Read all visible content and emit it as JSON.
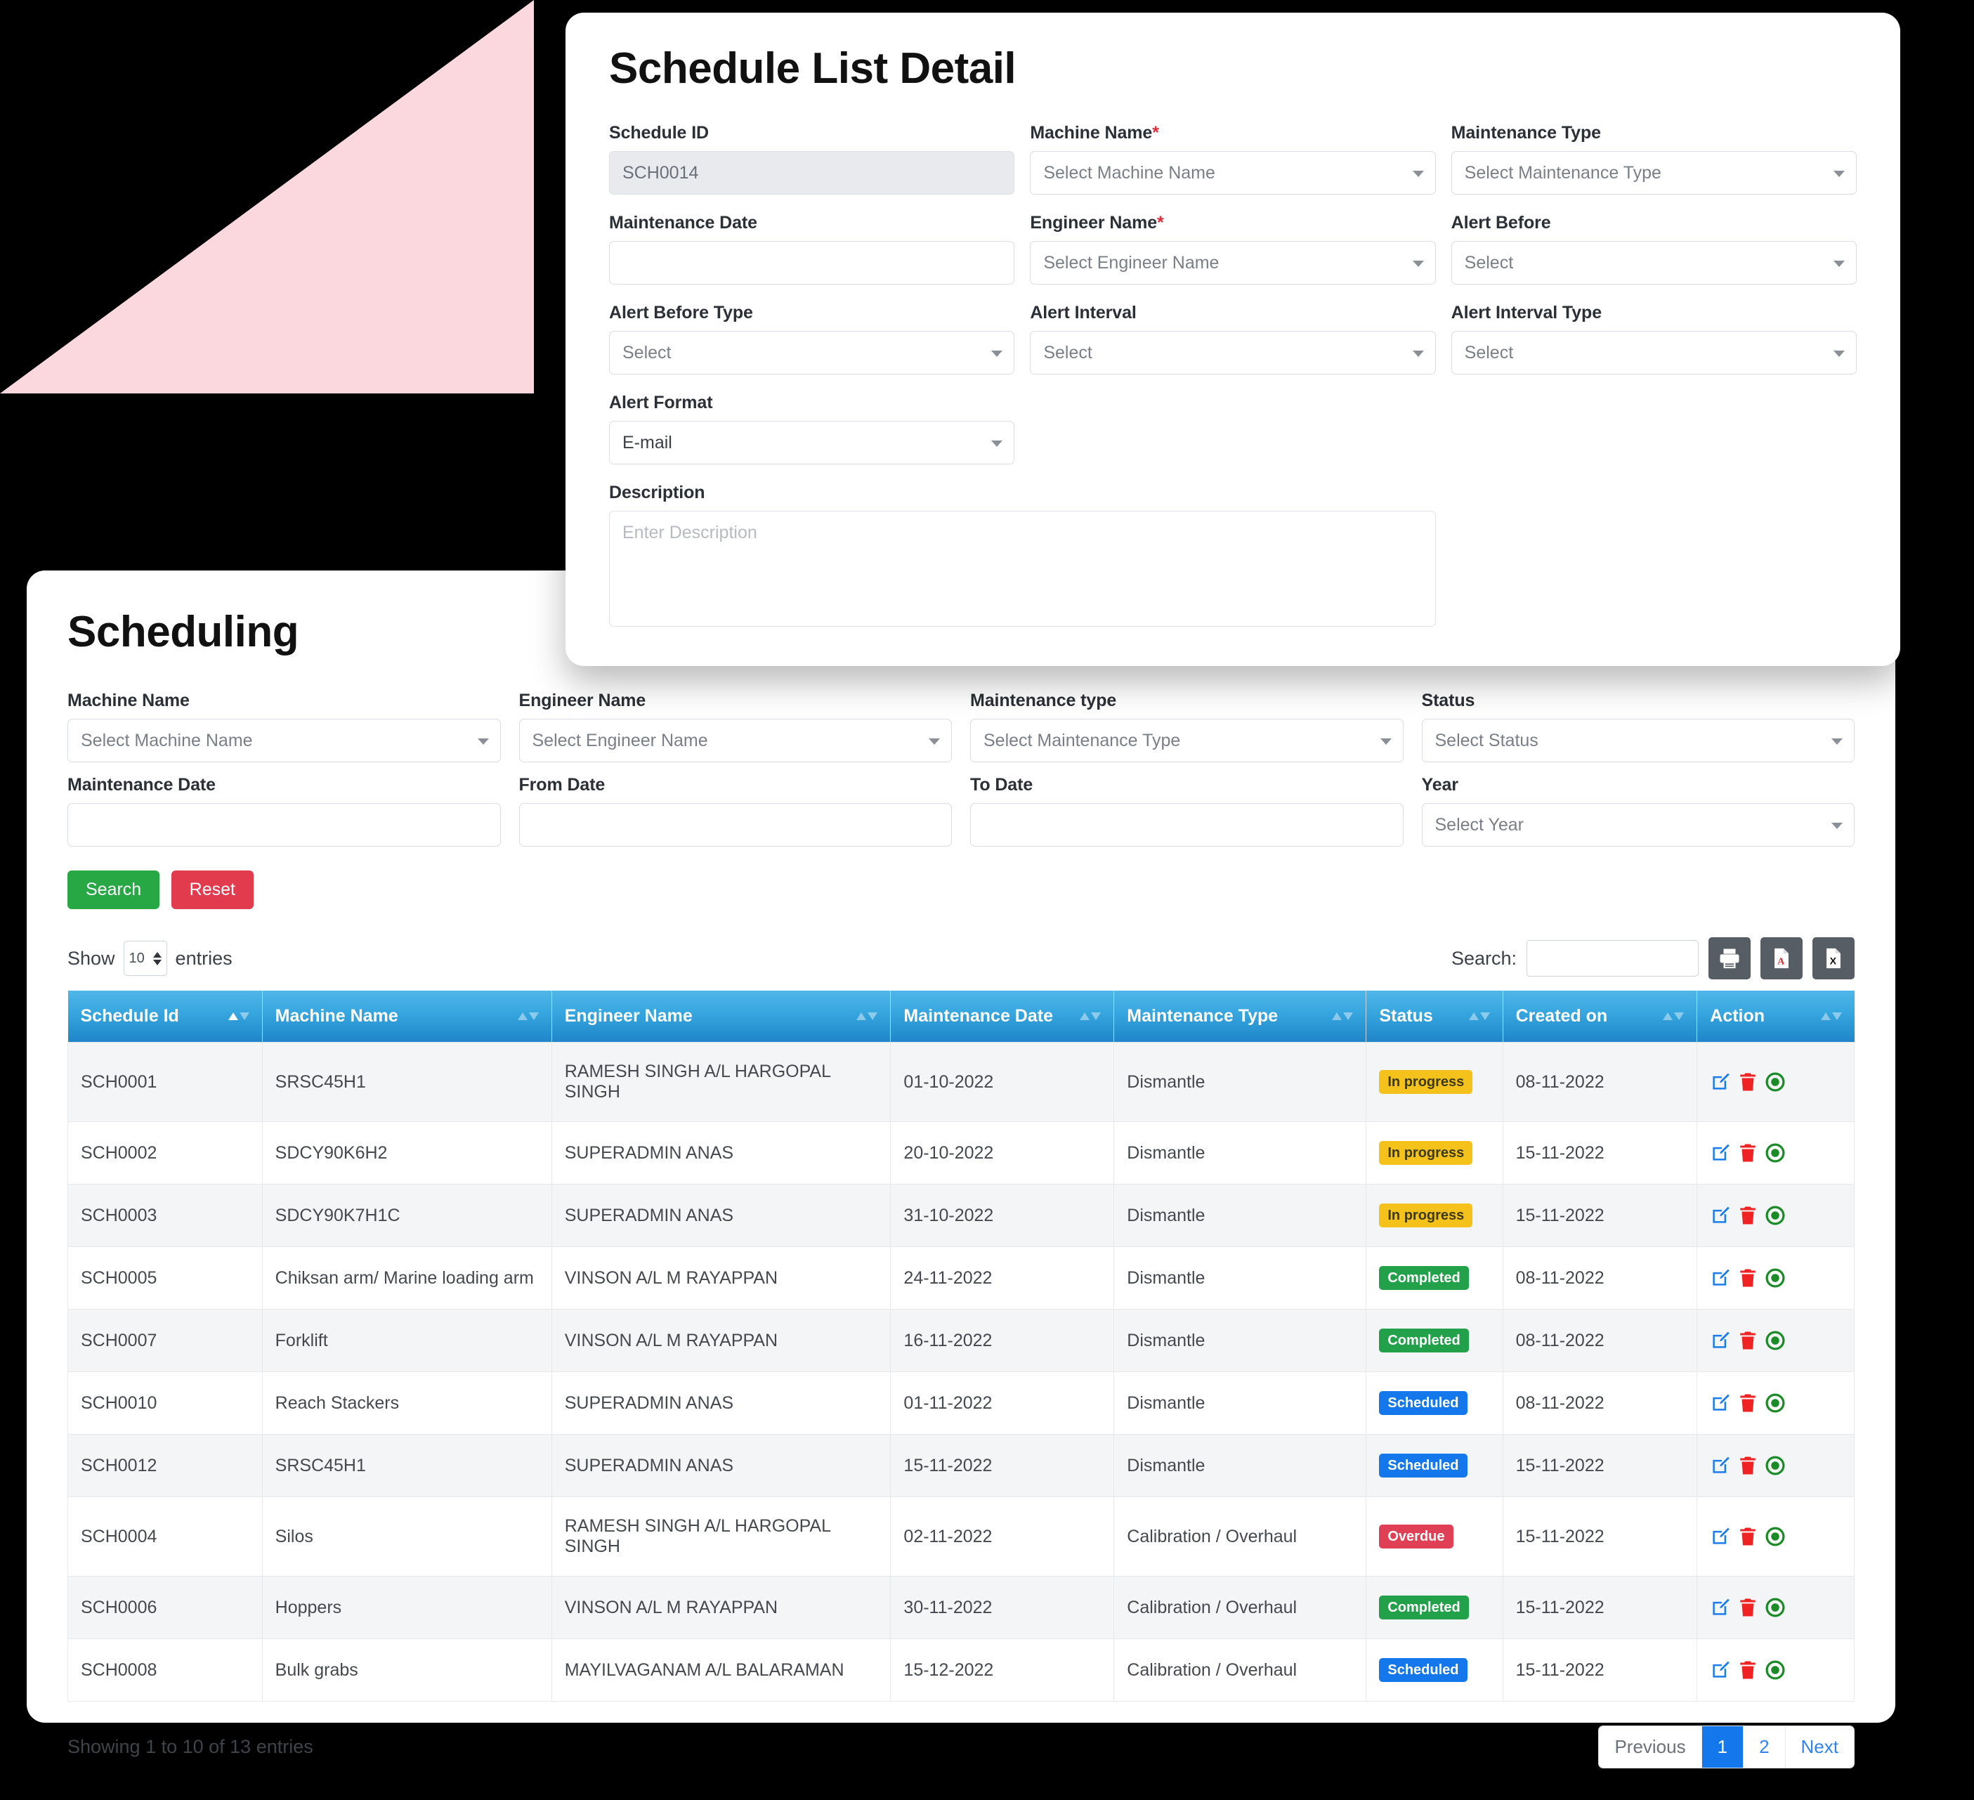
{
  "modal": {
    "title": "Schedule List Detail",
    "fields": [
      {
        "label": "Schedule ID",
        "required": false,
        "type": "text-readonly",
        "value": "SCH0014",
        "placeholder": ""
      },
      {
        "label": "Machine Name",
        "required": true,
        "type": "select",
        "value": "Select Machine Name"
      },
      {
        "label": "Maintenance Type",
        "required": false,
        "type": "select",
        "value": "Select Maintenance Type"
      },
      {
        "label": "Maintenance Date",
        "required": false,
        "type": "text",
        "value": ""
      },
      {
        "label": "Engineer Name",
        "required": true,
        "type": "select",
        "value": "Select Engineer Name"
      },
      {
        "label": "Alert Before",
        "required": false,
        "type": "select",
        "value": "Select"
      },
      {
        "label": "Alert Before Type",
        "required": false,
        "type": "select",
        "value": "Select"
      },
      {
        "label": "Alert Interval",
        "required": false,
        "type": "select",
        "value": "Select"
      },
      {
        "label": "Alert Interval Type",
        "required": false,
        "type": "select",
        "value": "Select"
      },
      {
        "label": "Alert Format",
        "required": false,
        "type": "select",
        "value": "E-mail"
      }
    ],
    "description": {
      "label": "Description",
      "placeholder": "Enter Description",
      "value": ""
    },
    "required_marker": "*"
  },
  "list": {
    "title": "Scheduling",
    "filters": [
      {
        "label": "Machine Name",
        "type": "select",
        "value": "Select Machine Name"
      },
      {
        "label": "Engineer Name",
        "type": "select",
        "value": "Select Engineer Name"
      },
      {
        "label": "Maintenance type",
        "type": "select",
        "value": "Select Maintenance Type"
      },
      {
        "label": "Status",
        "type": "select",
        "value": "Select Status"
      },
      {
        "label": "Maintenance Date",
        "type": "text",
        "value": ""
      },
      {
        "label": "From Date",
        "type": "text",
        "value": ""
      },
      {
        "label": "To Date",
        "type": "text",
        "value": ""
      },
      {
        "label": "Year",
        "type": "select",
        "value": "Select Year"
      }
    ],
    "buttons": {
      "search": "Search",
      "reset": "Reset"
    },
    "table_controls": {
      "show_label": "Show",
      "entries_value": "10",
      "entries_label": "entries",
      "search_label": "Search:",
      "search_value": "",
      "export": [
        {
          "name": "print-icon",
          "title": "Print"
        },
        {
          "name": "pdf-icon",
          "title": "PDF"
        },
        {
          "name": "excel-icon",
          "title": "Excel"
        }
      ]
    },
    "columns": [
      {
        "label": "Schedule Id",
        "sort": "asc"
      },
      {
        "label": "Machine Name",
        "sort": "none"
      },
      {
        "label": "Engineer Name",
        "sort": "none"
      },
      {
        "label": "Maintenance Date",
        "sort": "none"
      },
      {
        "label": "Maintenance Type",
        "sort": "none"
      },
      {
        "label": "Status",
        "sort": "none"
      },
      {
        "label": "Created on",
        "sort": "none"
      },
      {
        "label": "Action",
        "sort": "none"
      }
    ],
    "rows": [
      {
        "id": "SCH0001",
        "machine": "SRSC45H1",
        "engineer": "RAMESH SINGH A/L HARGOPAL SINGH",
        "date": "01-10-2022",
        "mtype": "Dismantle",
        "status": "In progress",
        "status_key": "inprogress",
        "created": "08-11-2022"
      },
      {
        "id": "SCH0002",
        "machine": "SDCY90K6H2",
        "engineer": "SUPERADMIN ANAS",
        "date": "20-10-2022",
        "mtype": "Dismantle",
        "status": "In progress",
        "status_key": "inprogress",
        "created": "15-11-2022"
      },
      {
        "id": "SCH0003",
        "machine": "SDCY90K7H1C",
        "engineer": "SUPERADMIN ANAS",
        "date": "31-10-2022",
        "mtype": "Dismantle",
        "status": "In progress",
        "status_key": "inprogress",
        "created": "15-11-2022"
      },
      {
        "id": "SCH0005",
        "machine": "Chiksan arm/ Marine loading arm",
        "engineer": "VINSON A/L M RAYAPPAN",
        "date": "24-11-2022",
        "mtype": "Dismantle",
        "status": "Completed",
        "status_key": "completed",
        "created": "08-11-2022"
      },
      {
        "id": "SCH0007",
        "machine": "Forklift",
        "engineer": "VINSON A/L M RAYAPPAN",
        "date": "16-11-2022",
        "mtype": "Dismantle",
        "status": "Completed",
        "status_key": "completed",
        "created": "08-11-2022"
      },
      {
        "id": "SCH0010",
        "machine": "Reach Stackers",
        "engineer": "SUPERADMIN ANAS",
        "date": "01-11-2022",
        "mtype": "Dismantle",
        "status": "Scheduled",
        "status_key": "scheduled",
        "created": "08-11-2022"
      },
      {
        "id": "SCH0012",
        "machine": "SRSC45H1",
        "engineer": "SUPERADMIN ANAS",
        "date": "15-11-2022",
        "mtype": "Dismantle",
        "status": "Scheduled",
        "status_key": "scheduled",
        "created": "15-11-2022"
      },
      {
        "id": "SCH0004",
        "machine": "Silos",
        "engineer": "RAMESH SINGH A/L HARGOPAL SINGH",
        "date": "02-11-2022",
        "mtype": "Calibration / Overhaul",
        "status": "Overdue",
        "status_key": "overdue",
        "created": "15-11-2022"
      },
      {
        "id": "SCH0006",
        "machine": "Hoppers",
        "engineer": "VINSON A/L M RAYAPPAN",
        "date": "30-11-2022",
        "mtype": "Calibration / Overhaul",
        "status": "Completed",
        "status_key": "completed",
        "created": "15-11-2022"
      },
      {
        "id": "SCH0008",
        "machine": "Bulk grabs",
        "engineer": "MAYILVAGANAM A/L BALARAMAN",
        "date": "15-12-2022",
        "mtype": "Calibration / Overhaul",
        "status": "Scheduled",
        "status_key": "scheduled",
        "created": "15-11-2022"
      }
    ],
    "row_actions": [
      {
        "name": "edit-icon",
        "color": "#1b7ced"
      },
      {
        "name": "delete-icon",
        "color": "#ef2323"
      },
      {
        "name": "view-icon",
        "color": "#1a8b26"
      }
    ],
    "footer": {
      "showing": "Showing 1 to 10 of 13 entries",
      "pagination": {
        "previous": "Previous",
        "pages": [
          "1",
          "2"
        ],
        "active_page": "1",
        "next": "Next"
      }
    }
  },
  "colors": {
    "accent_blue": "#1f86c9",
    "header_gradient_top": "#4fb6e8",
    "header_gradient_bottom": "#1f86c9",
    "success": "#28a745",
    "danger": "#e23b4e",
    "warning": "#f5c21b",
    "scheduled": "#1478ec",
    "pink_decor": "#fbd8de"
  }
}
